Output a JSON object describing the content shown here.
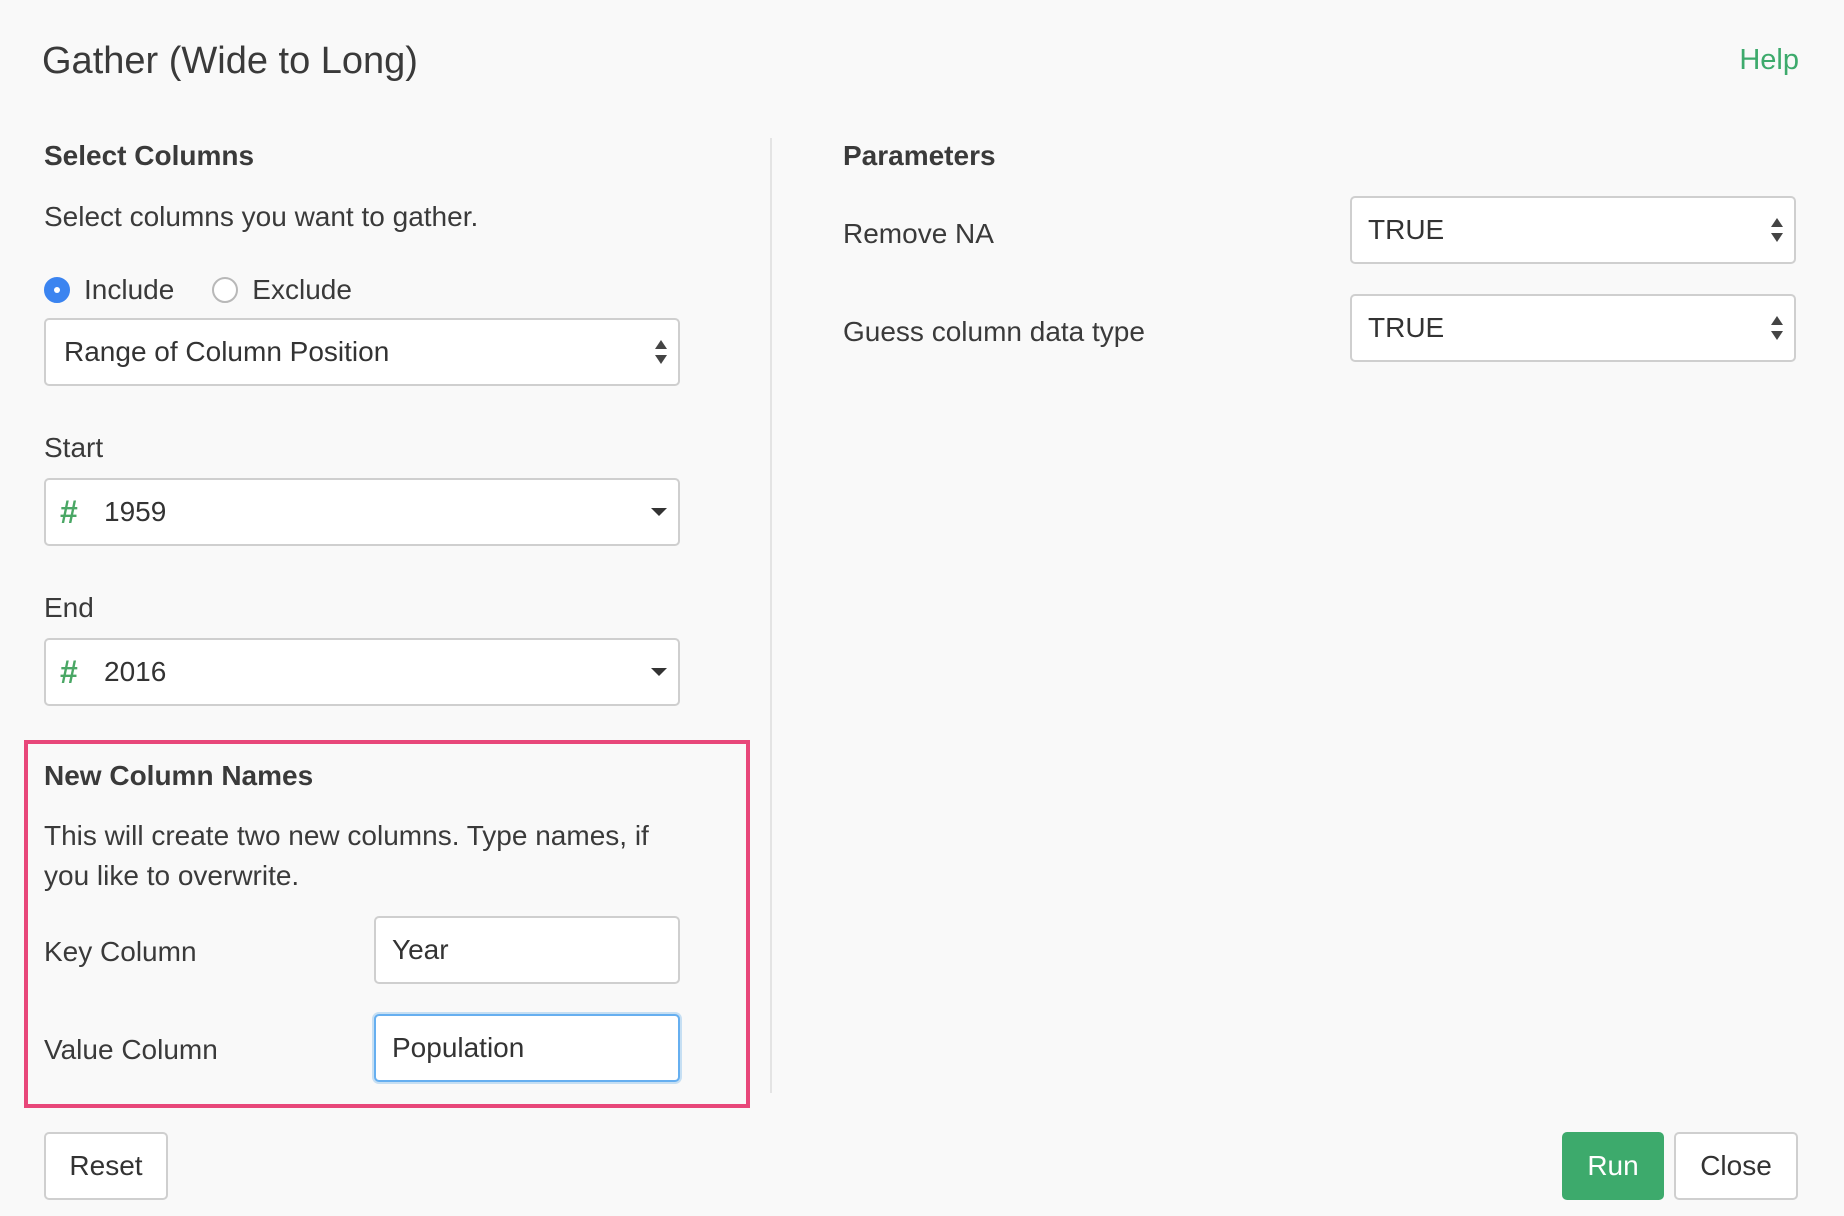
{
  "dialog": {
    "title": "Gather (Wide to Long)",
    "help_label": "Help"
  },
  "select_columns": {
    "heading": "Select Columns",
    "description": "Select columns you want to gather.",
    "mode_options": [
      {
        "label": "Include",
        "selected": true
      },
      {
        "label": "Exclude",
        "selected": false
      }
    ],
    "method_value": "Range of Column Position",
    "start_label": "Start",
    "start_value": "1959",
    "start_type_icon": "hash-icon",
    "end_label": "End",
    "end_value": "2016",
    "end_type_icon": "hash-icon"
  },
  "new_columns": {
    "heading": "New Column Names",
    "description": "This will create two new columns. Type names, if you like to overwrite.",
    "key_label": "Key Column",
    "key_value": "Year",
    "value_label": "Value Column",
    "value_value": "Population"
  },
  "parameters": {
    "heading": "Parameters",
    "remove_na_label": "Remove NA",
    "remove_na_value": "TRUE",
    "guess_type_label": "Guess column data type",
    "guess_type_value": "TRUE"
  },
  "footer": {
    "reset_label": "Reset",
    "run_label": "Run",
    "close_label": "Close"
  },
  "colors": {
    "accent_green": "#3daa6c",
    "highlight_pink": "#e8477a",
    "radio_blue": "#3b84f0"
  }
}
